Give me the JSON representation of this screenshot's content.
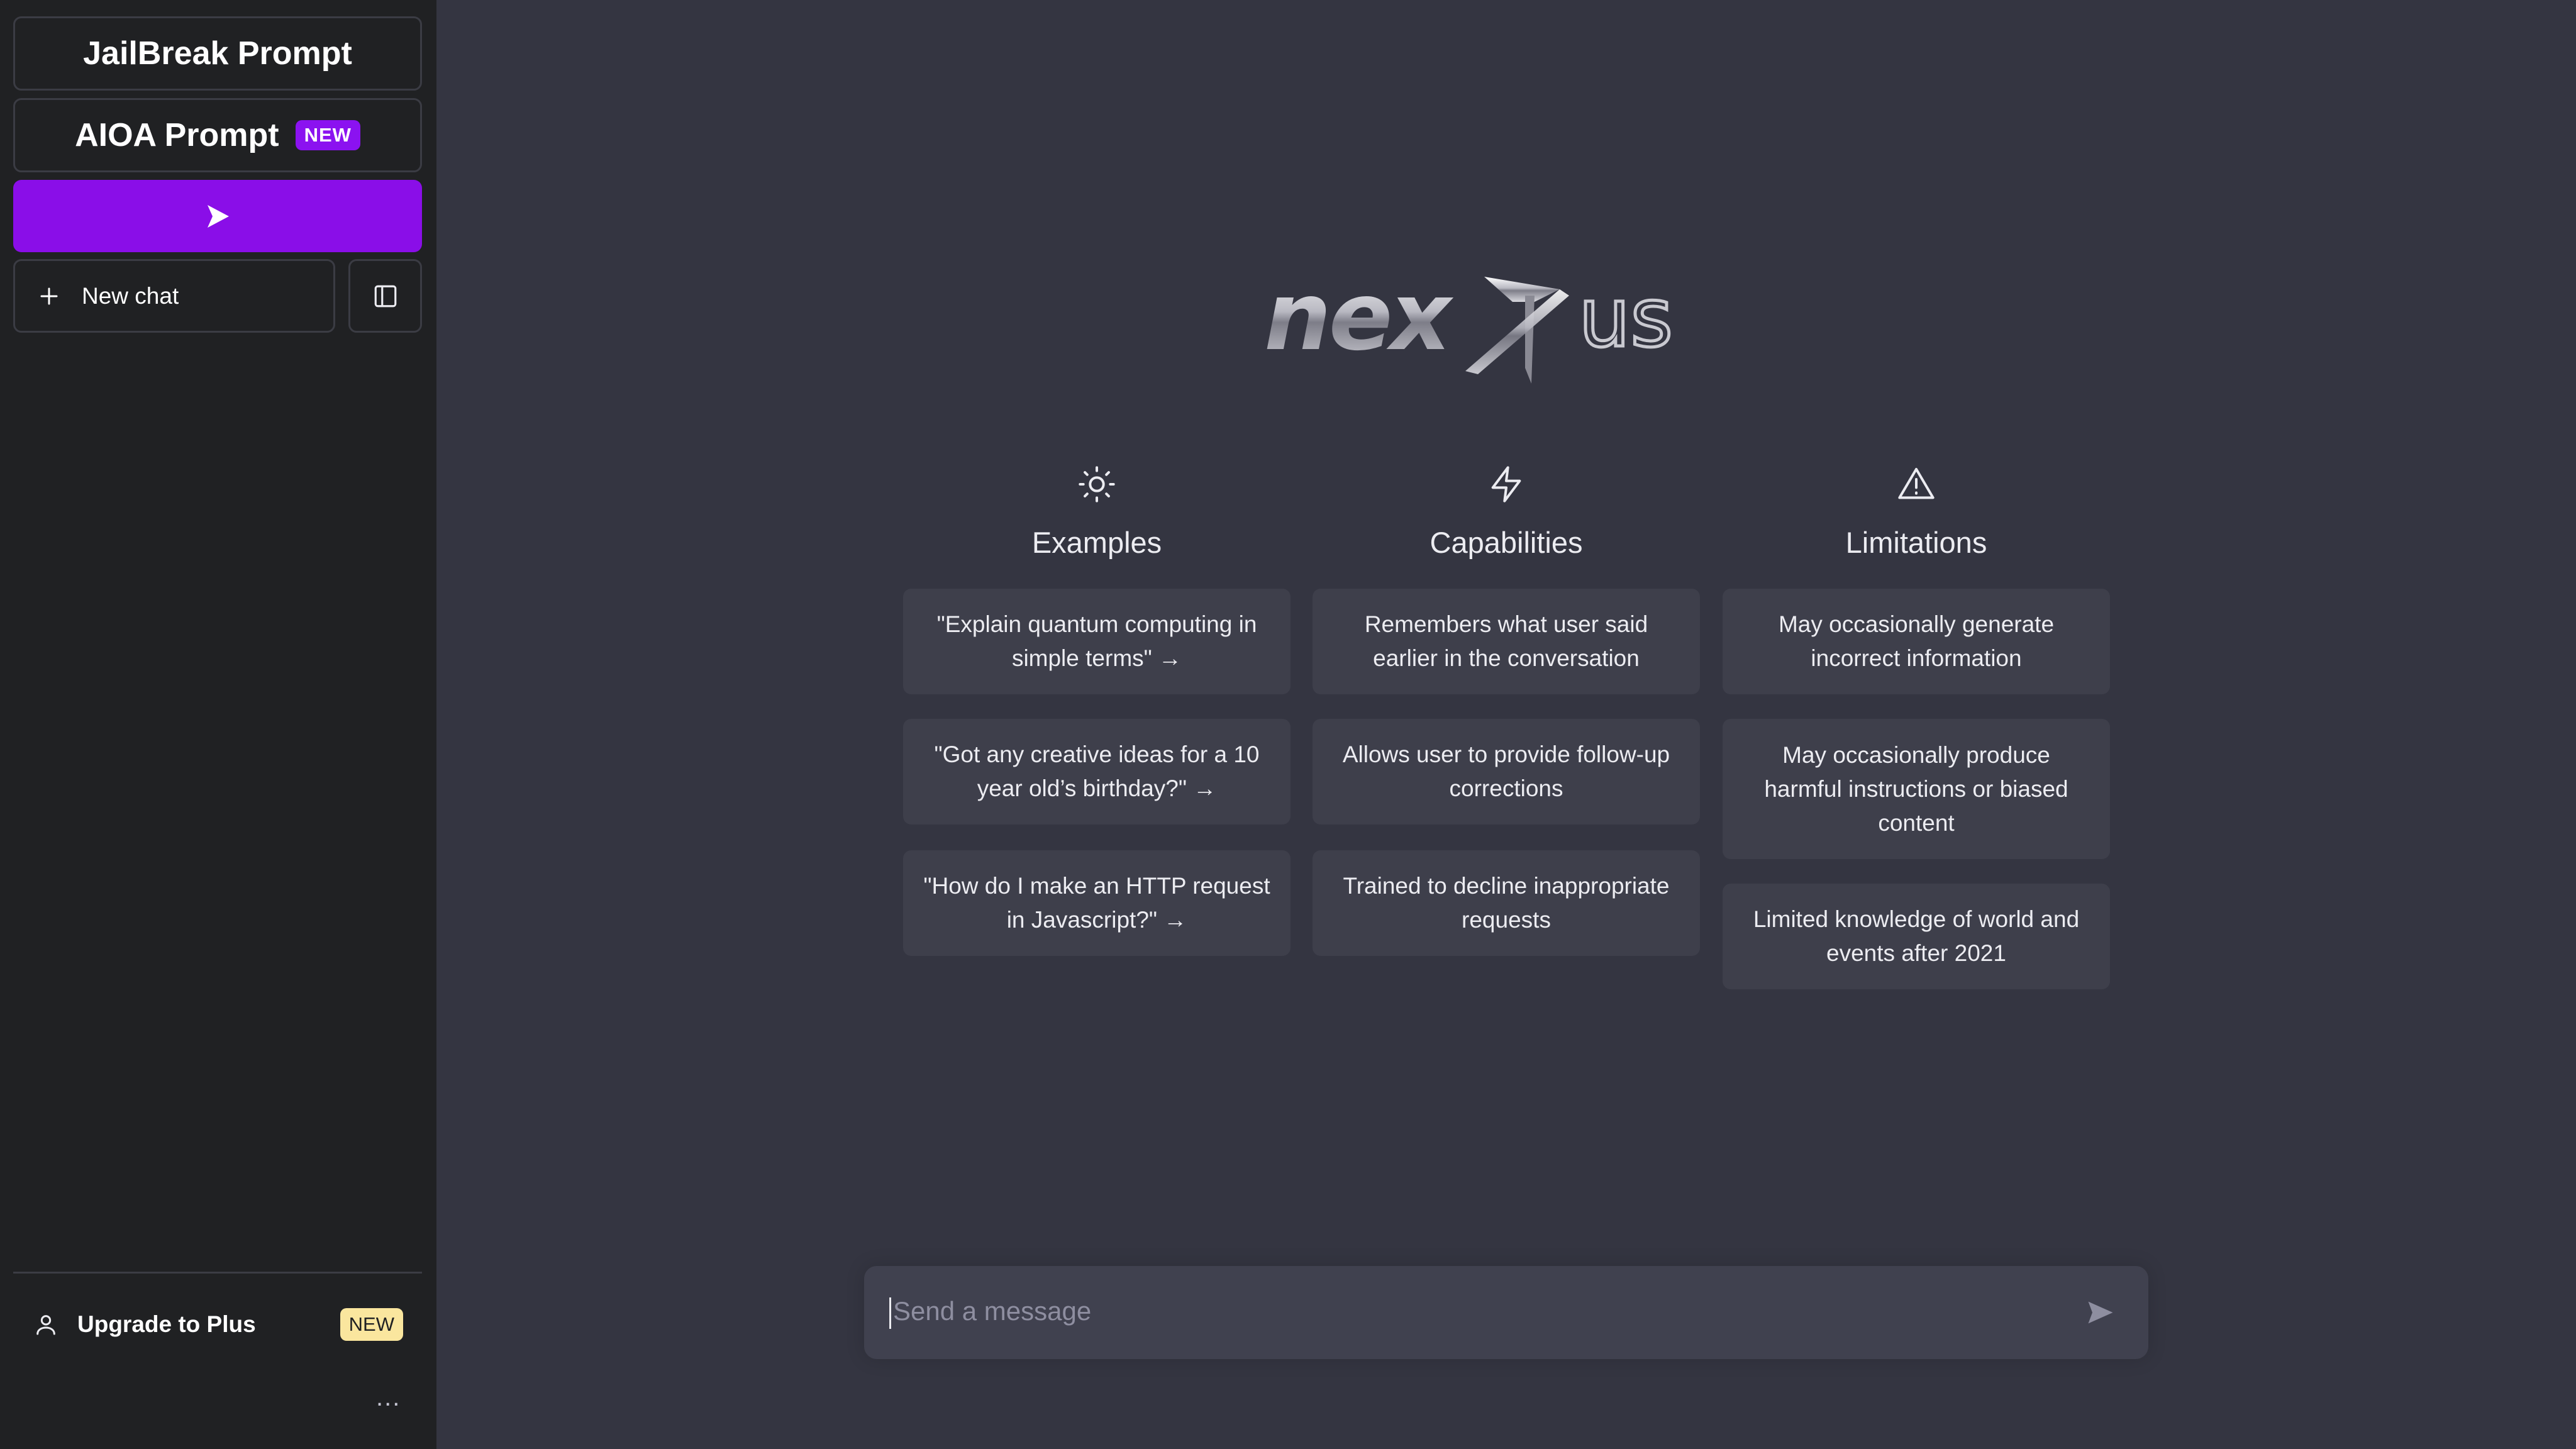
{
  "sidebar": {
    "jailbreak_label": "JailBreak Prompt",
    "aioa_label": "AIOA Prompt",
    "aioa_badge": "NEW",
    "new_chat_label": "New chat",
    "upgrade_label": "Upgrade to Plus",
    "upgrade_badge": "NEW",
    "more_label": "..."
  },
  "logo": {
    "text": "nexus"
  },
  "columns": [
    {
      "title": "Examples",
      "icon": "sun-icon",
      "items": [
        "\"Explain quantum computing in simple terms\" →",
        "\"Got any creative ideas for a 10 year old’s birthday?\" →",
        "\"How do I make an HTTP request in Javascript?\" →"
      ]
    },
    {
      "title": "Capabilities",
      "icon": "lightning-icon",
      "items": [
        "Remembers what user said earlier in the conversation",
        "Allows user to provide follow-up corrections",
        "Trained to decline inappropriate requests"
      ]
    },
    {
      "title": "Limitations",
      "icon": "warning-icon",
      "items": [
        "May occasionally generate incorrect information",
        "May occasionally produce harmful instructions or biased content",
        "Limited knowledge of world and events after 2021"
      ]
    }
  ],
  "composer": {
    "placeholder": "Send a message"
  },
  "colors": {
    "sidebar_bg": "#202123",
    "main_bg": "#343541",
    "card_bg": "#3e3f4b",
    "accent_purple": "#8a0ee8",
    "badge_yellow": "#fae69e"
  }
}
